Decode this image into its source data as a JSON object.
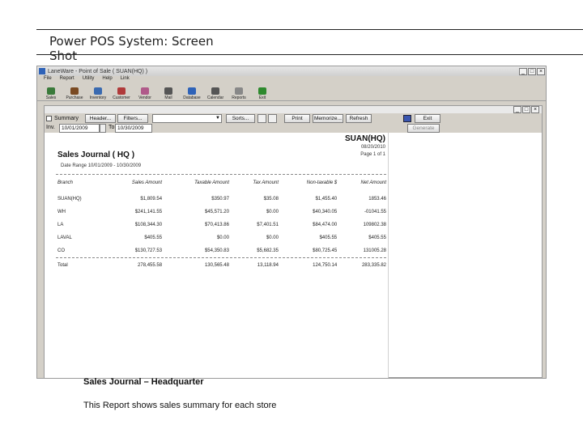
{
  "slide": {
    "title": "Power POS System: Screen Shot"
  },
  "app": {
    "window_title": "LaneWare - Point of Sale ( SUAN(HQ) )",
    "window_buttons": [
      "_",
      "□",
      "×"
    ],
    "menu": [
      "File",
      "Report",
      "Utility",
      "Help",
      "Link"
    ],
    "toolbar": [
      {
        "label": "Sales",
        "icon": "cart-icon",
        "color": "#3a7a3a"
      },
      {
        "label": "Purchase",
        "icon": "truck-icon",
        "color": "#7a4a22"
      },
      {
        "label": "Inventory",
        "icon": "box-icon",
        "color": "#3a6ab0"
      },
      {
        "label": "Customer",
        "icon": "person-icon",
        "color": "#b03a3a"
      },
      {
        "label": "Vendor",
        "icon": "vendor-icon",
        "color": "#b05a8a"
      },
      {
        "label": "Mail",
        "icon": "mail-icon",
        "color": "#555555"
      },
      {
        "label": "Database",
        "icon": "database-icon",
        "color": "#2f63b8"
      },
      {
        "label": "Calendar",
        "icon": "calendar-icon",
        "color": "#555555"
      },
      {
        "label": "Reports",
        "icon": "report-icon",
        "color": "#888888"
      },
      {
        "label": "Exit",
        "icon": "exit-icon",
        "color": "#2e8a2e"
      }
    ]
  },
  "report_window": {
    "buttons": [
      "_",
      "□",
      "×"
    ],
    "summary_label": "Summary",
    "header_button": "Header...",
    "filters_button": "Filters...",
    "sorts_button": "Sorts...",
    "print_button": "Print",
    "memorize_button": "Memorize...",
    "refresh_button": "Refresh",
    "exit_button": "Exit",
    "generate_button": "Generate",
    "inv_label": "Inv.",
    "date_from": "10/01/2009",
    "to_label": "To",
    "date_to": "10/30/2009"
  },
  "report": {
    "title": "Sales Journal ( HQ )",
    "date_range": "Date Range  10/01/2009 - 10/30/2009",
    "store": "SUAN(HQ)",
    "print_date": "08/20/2010",
    "page": "Page 1 of 1",
    "columns": [
      "Branch",
      "Sales Amount",
      "Taxable Amount",
      "Tax Amount",
      "Non-taxable $",
      "Net Amount"
    ],
    "rows": [
      [
        "SUAN(HQ)",
        "$1,809.54",
        "$350.97",
        "$35.08",
        "$1,455.40",
        "1853.46"
      ],
      [
        "WH",
        "$241,141.55",
        "$45,571.20",
        "$0.00",
        "$40,340.05",
        "-01041.55"
      ],
      [
        "LA",
        "$108,344.30",
        "$70,413.86",
        "$7,401.51",
        "$84,474.00",
        "109802.38"
      ],
      [
        "LAVAL",
        "$405.55",
        "$0.00",
        "$0.00",
        "$405.55",
        "$405.55"
      ],
      [
        "CO",
        "$130,727.53",
        "$54,350.83",
        "$5,682.35",
        "$80,725.45",
        "131005.28"
      ]
    ],
    "total": [
      "Total",
      "278,455.58",
      "130,565.48",
      "13,118.94",
      "124,750.14",
      "283,335.82"
    ]
  },
  "captions": {
    "title": "Sales Journal – Headquarter",
    "text": "This Report shows sales summary for each store"
  }
}
